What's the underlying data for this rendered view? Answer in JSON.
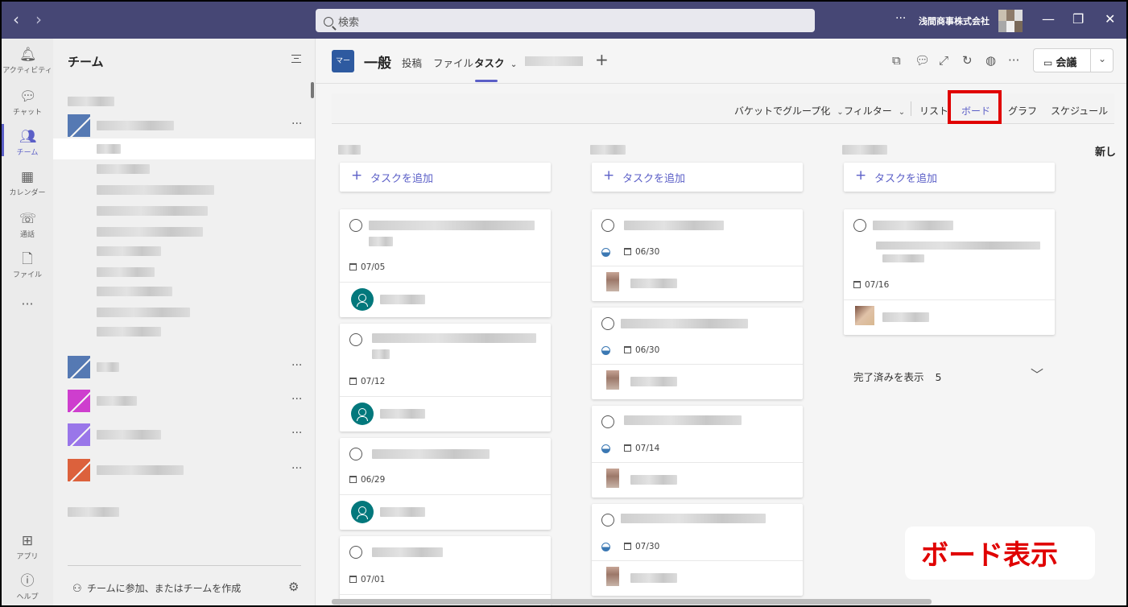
{
  "titlebar": {
    "back": "‹",
    "forward": "›",
    "search_placeholder": "検索",
    "more": "···",
    "org_name": "浅間商事株式会社",
    "minimize": "—",
    "restore": "❐",
    "close": "✕"
  },
  "rail": {
    "items": [
      {
        "label": "アクティビティ",
        "icon": "bell-icon"
      },
      {
        "label": "チャット",
        "icon": "chat-icon"
      },
      {
        "label": "チーム",
        "icon": "teams-icon"
      },
      {
        "label": "カレンダー",
        "icon": "calendar-icon"
      },
      {
        "label": "通話",
        "icon": "phone-icon"
      },
      {
        "label": "ファイル",
        "icon": "file-icon"
      }
    ],
    "more": "···",
    "apps_label": "アプリ",
    "help_label": "ヘルプ"
  },
  "panel": {
    "title": "チーム",
    "team_colors": [
      "#3a64a8",
      "#3a64a8",
      "#c81ec8",
      "#8a60e8",
      "#d9481c"
    ],
    "team_more": "···",
    "join_label": "チームに参加、またはチームを作成"
  },
  "channel": {
    "avatar": "マー",
    "name": "一般",
    "tabs": [
      "投稿",
      "ファイル",
      "タスク"
    ],
    "active_tab": "タスク",
    "tab_chevron": "⌄",
    "add_tab": "+",
    "meeting_label": "会議"
  },
  "planner": {
    "toolbar": {
      "group_by": "バケットでグループ化",
      "filter": "フィルター",
      "list": "リスト",
      "board": "ボード",
      "chart": "グラフ",
      "schedule": "スケジュール"
    },
    "new_bucket": "新し",
    "add_task": "タスクを追加",
    "buckets": [
      {
        "cards": [
          {
            "date": "07/05"
          },
          {
            "date": "07/12"
          },
          {
            "date": "06/29"
          },
          {
            "date": "07/01"
          }
        ]
      },
      {
        "cards": [
          {
            "date": "06/30"
          },
          {
            "date": "06/30"
          },
          {
            "date": "07/14"
          },
          {
            "date": "07/30"
          }
        ]
      },
      {
        "cards": [
          {
            "date": "07/16"
          }
        ],
        "show_completed": "完了済みを表示",
        "completed_count": "5"
      }
    ]
  },
  "annotation": "ボード表示",
  "accent": "#5b5fc7",
  "highlight": "#e00000"
}
